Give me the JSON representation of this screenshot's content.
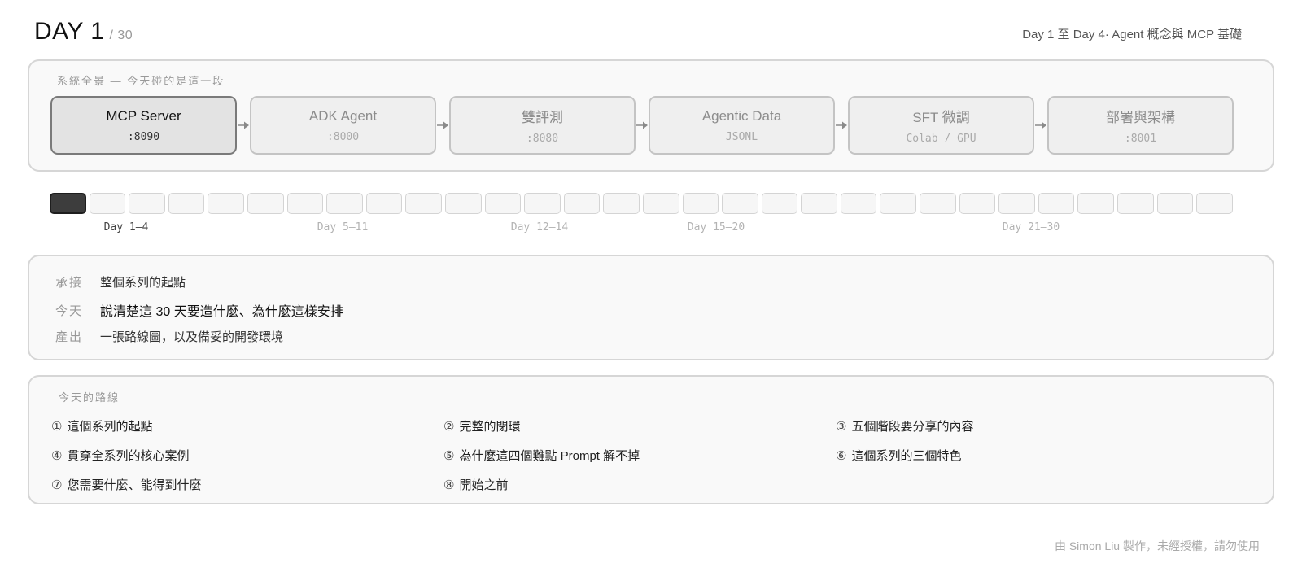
{
  "header": {
    "title": "DAY 1",
    "total": "/ 30",
    "subtitle": "Day 1 至 Day 4· Agent 概念與 MCP 基礎"
  },
  "pipeline": {
    "label": "系統全景 — 今天碰的是這一段",
    "stages": [
      {
        "name": "MCP Server",
        "sub": ":8090",
        "active": true
      },
      {
        "name": "ADK Agent",
        "sub": ":8000",
        "active": false
      },
      {
        "name": "雙評測",
        "sub": ":8080",
        "active": false
      },
      {
        "name": "Agentic Data",
        "sub": "JSONL",
        "active": false
      },
      {
        "name": "SFT 微調",
        "sub": "Colab / GPU",
        "active": false
      },
      {
        "name": "部署與架構",
        "sub": ":8001",
        "active": false
      }
    ]
  },
  "track": {
    "total_days": 30,
    "current_day": 1,
    "labels": [
      {
        "text": "Day 1–4",
        "current": true
      },
      {
        "text": "Day 5–11",
        "current": false
      },
      {
        "text": "Day 12–14",
        "current": false
      },
      {
        "text": "Day 15–20",
        "current": false
      },
      {
        "text": "Day 21–30",
        "current": false
      }
    ]
  },
  "context": {
    "rows": [
      {
        "key": "承接",
        "value": "整個系列的起點"
      },
      {
        "key": "今天",
        "value": "說清楚這 30 天要造什麼、為什麼這樣安排"
      },
      {
        "key": "產出",
        "value": "一張路線圖，以及備妥的開發環境"
      }
    ]
  },
  "route": {
    "label": "今天的路線",
    "items": [
      {
        "num": "①",
        "text": "這個系列的起點"
      },
      {
        "num": "②",
        "text": "完整的閉環"
      },
      {
        "num": "③",
        "text": "五個階段要分享的內容"
      },
      {
        "num": "④",
        "text": "貫穿全系列的核心案例"
      },
      {
        "num": "⑤",
        "text": "為什麼這四個難點 Prompt 解不掉"
      },
      {
        "num": "⑥",
        "text": "這個系列的三個特色"
      },
      {
        "num": "⑦",
        "text": "您需要什麼、能得到什麼"
      },
      {
        "num": "⑧",
        "text": "開始之前"
      }
    ]
  },
  "footer": {
    "text": "由 Simon Liu 製作，未經授權，請勿使用"
  }
}
